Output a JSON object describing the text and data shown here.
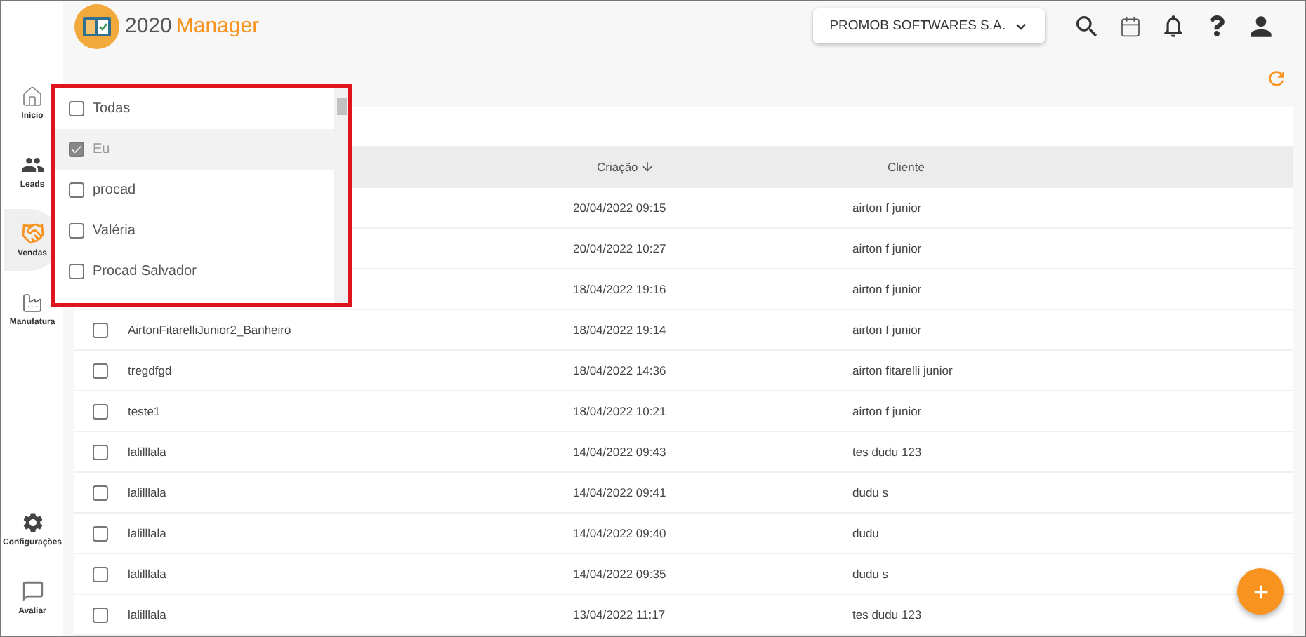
{
  "logo": {
    "prefix": "2020",
    "name": "Manager"
  },
  "sidebar": {
    "items": [
      {
        "label": "Início",
        "selected": false
      },
      {
        "label": "Leads",
        "selected": false
      },
      {
        "label": "Vendas",
        "selected": true
      },
      {
        "label": "Manufatura",
        "selected": false
      }
    ],
    "bottom_items": [
      {
        "label": "Configurações",
        "selected": false
      },
      {
        "label": "Avaliar",
        "selected": false
      }
    ]
  },
  "header": {
    "company": "PROMOB SOFTWARES S.A."
  },
  "table": {
    "columns": [
      {
        "label": "Criação",
        "sorted": true
      },
      {
        "label": "Cliente",
        "sorted": false
      }
    ],
    "rows": [
      {
        "created": "20/04/2022 09:15",
        "client": "airton f junior"
      },
      {
        "created": "20/04/2022 10:27",
        "client": "airton f junior"
      },
      {
        "created": "18/04/2022 19:16",
        "client": "airton f junior"
      },
      {
        "name": "AirtonFitarelliJunior2_Banheiro",
        "created": "18/04/2022 19:14",
        "client": "airton f junior",
        "checked": false
      },
      {
        "name": "tregdfgd",
        "created": "18/04/2022 14:36",
        "client": "airton fitarelli junior",
        "checked": false
      },
      {
        "name": "teste1",
        "created": "18/04/2022 10:21",
        "client": "airton f junior",
        "checked": false
      },
      {
        "name": "lalilllala",
        "created": "14/04/2022 09:43",
        "client": "tes dudu 123",
        "checked": false
      },
      {
        "name": "lalilllala",
        "created": "14/04/2022 09:41",
        "client": "dudu s",
        "checked": false
      },
      {
        "name": "lalilllala",
        "created": "14/04/2022 09:40",
        "client": "dudu",
        "checked": false
      },
      {
        "name": "lalilllala",
        "created": "14/04/2022 09:35",
        "client": "dudu s",
        "checked": false
      },
      {
        "name": "lalilllala",
        "created": "13/04/2022 11:17",
        "client": "tes dudu 123",
        "checked": false
      }
    ]
  },
  "filter_dropdown": {
    "options": [
      {
        "label": "Todas",
        "checked": false
      },
      {
        "label": "Eu",
        "checked": true
      },
      {
        "label": "procad",
        "checked": false
      },
      {
        "label": "Valéria",
        "checked": false
      },
      {
        "label": "Procad Salvador",
        "checked": false
      }
    ]
  }
}
